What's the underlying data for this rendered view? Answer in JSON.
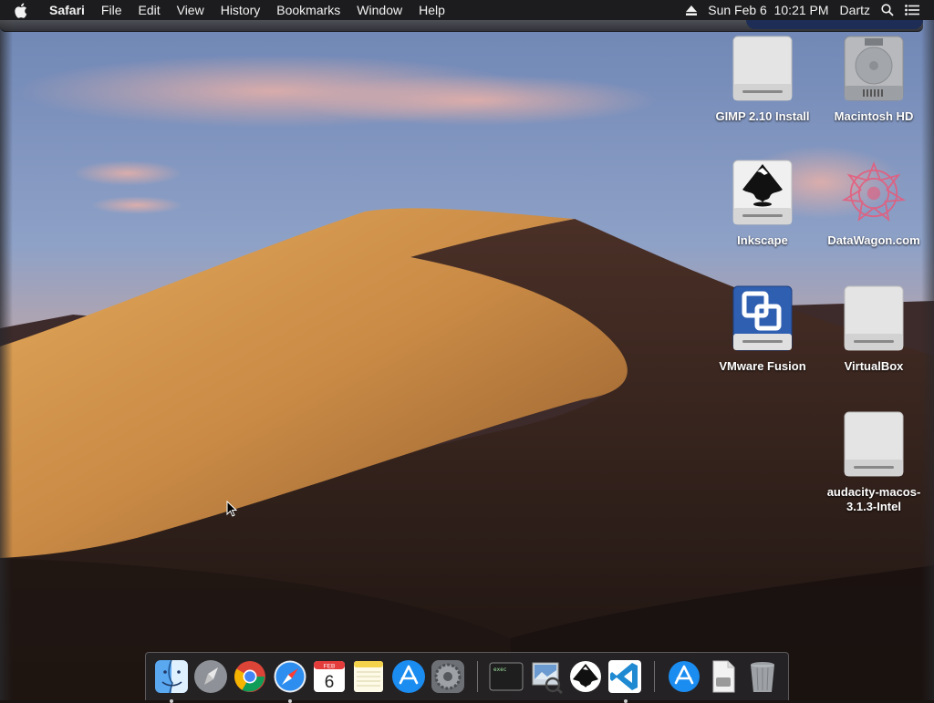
{
  "menubar": {
    "apple_icon": "apple-icon",
    "app_name": "Safari",
    "items": [
      "File",
      "Edit",
      "View",
      "History",
      "Bookmarks",
      "Window",
      "Help"
    ],
    "eject_icon": "eject-icon",
    "datetime": "Sun Feb 6  10:21 PM",
    "user": "Dartz",
    "search_icon": "search-icon",
    "list_icon": "notification-list-icon"
  },
  "desktop": {
    "icons": [
      {
        "label": "GIMP 2.10 Install",
        "icon": "drive-icon"
      },
      {
        "label": "Macintosh HD",
        "icon": "hard-drive-icon"
      },
      {
        "label": "Inkscape",
        "icon": "inkscape-drive-icon"
      },
      {
        "label": "DataWagon.com",
        "icon": "datawagon-icon"
      },
      {
        "label": "VMware Fusion",
        "icon": "vmware-drive-icon"
      },
      {
        "label": "VirtualBox",
        "icon": "drive-icon"
      },
      {
        "label": "audacity-macos-3.1.3-Intel",
        "icon": "drive-icon"
      }
    ]
  },
  "dock": {
    "calendar": {
      "month": "FEB",
      "day": "6"
    },
    "terminal_text": "exec",
    "apps": [
      "finder-icon",
      "launchpad-icon",
      "chrome-icon",
      "safari-icon",
      "calendar-icon",
      "notes-icon",
      "app-store-icon",
      "system-preferences-icon",
      "terminal-icon",
      "preview-icon",
      "inkscape-icon",
      "vscode-icon",
      "app-store-installer-icon",
      "file-icon",
      "trash-icon"
    ]
  },
  "colors": {
    "menubar": "#1c1c1e",
    "sky_top": "#6f86b4",
    "dune_light": "#d89a52",
    "dune_shadow": "#2a1c17"
  }
}
